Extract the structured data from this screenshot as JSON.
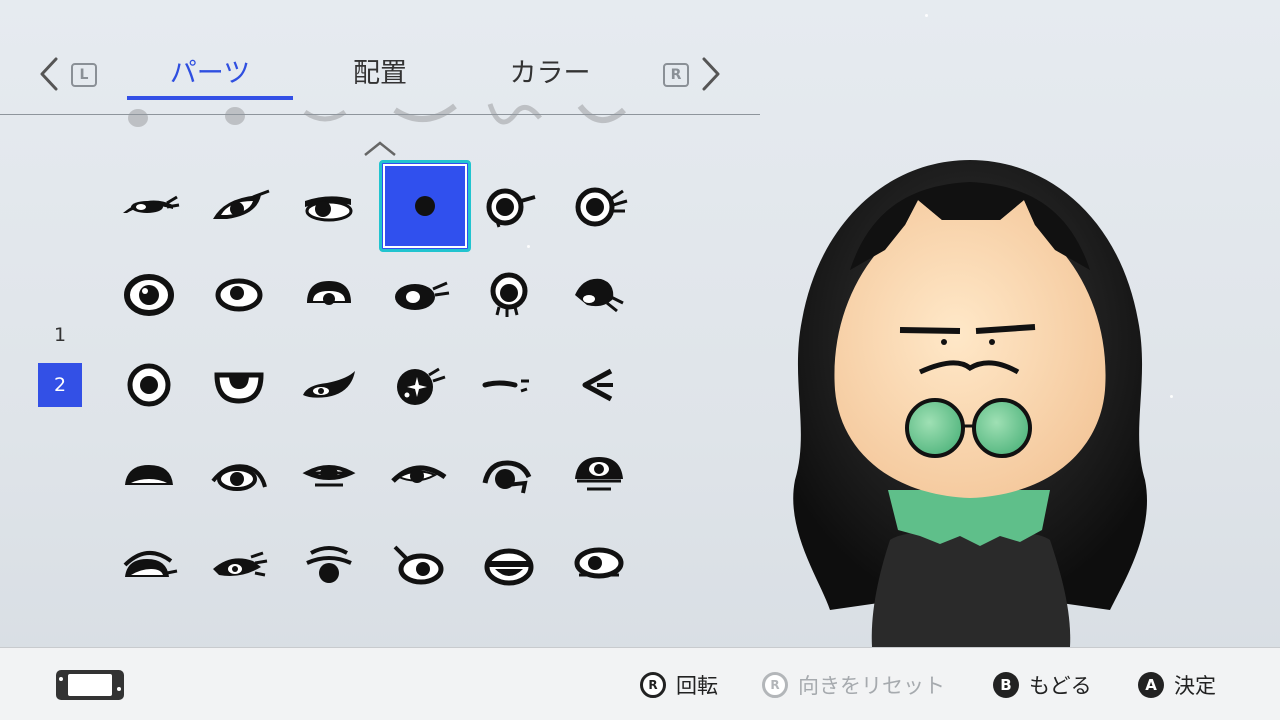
{
  "tabs": {
    "left_key": "L",
    "right_key": "R",
    "items": [
      {
        "label": "パーツ",
        "active": true
      },
      {
        "label": "配置",
        "active": false
      },
      {
        "label": "カラー",
        "active": false
      }
    ]
  },
  "pages": {
    "items": [
      "1",
      "2"
    ],
    "current": "2"
  },
  "grid": {
    "rows": 5,
    "cols": 6,
    "selected_index": 3
  },
  "hints": [
    {
      "button": "R",
      "label": "回転",
      "enabled": true
    },
    {
      "button": "R",
      "label": "向きをリセット",
      "enabled": false
    },
    {
      "button": "B",
      "label": "もどる",
      "enabled": true
    },
    {
      "button": "A",
      "label": "決定",
      "enabled": true
    }
  ],
  "colors": {
    "accent": "#3350e6",
    "selection_border": "#21c4cf",
    "disabled_text": "#a6aaae"
  }
}
